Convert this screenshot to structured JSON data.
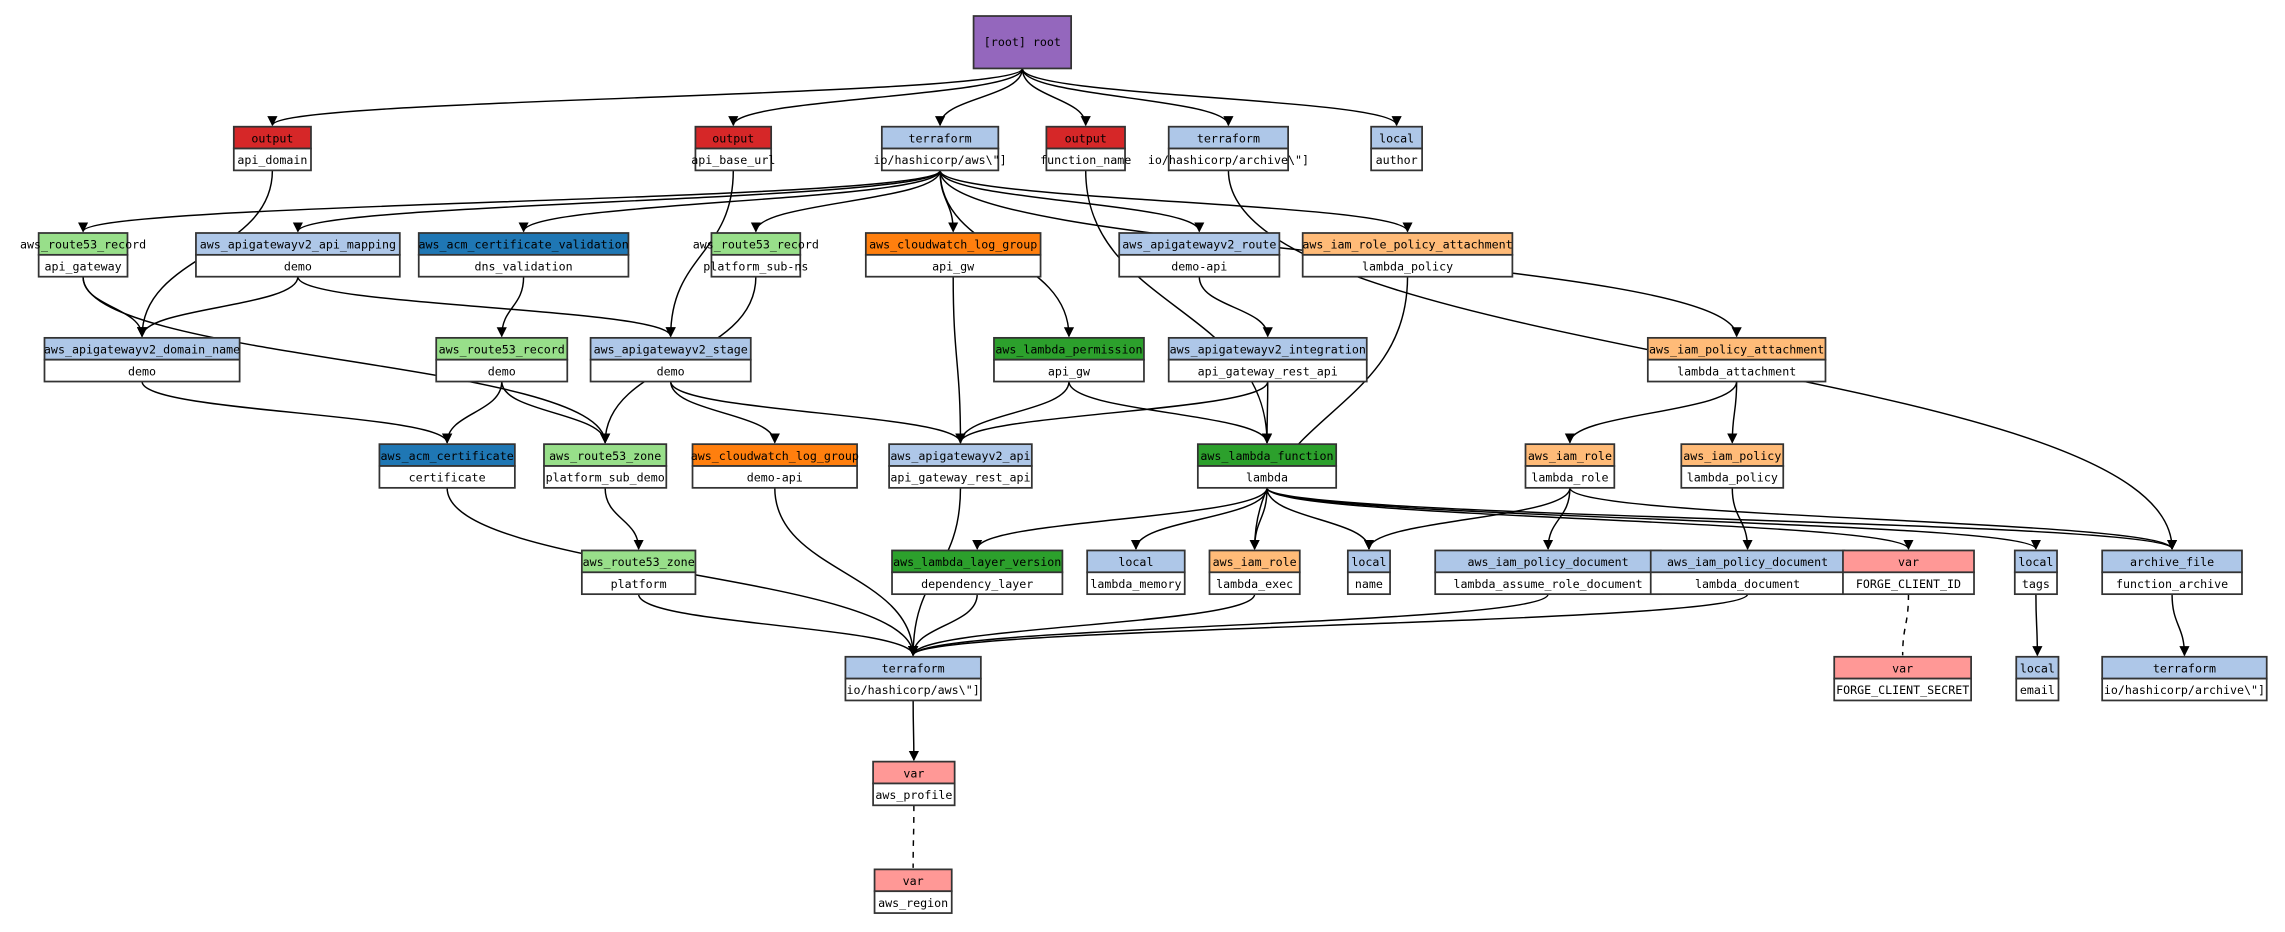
{
  "colors": {
    "root": "#9467bd",
    "output": "#d62728",
    "provider": "#aec7e8",
    "local": "#aec7e8",
    "apigateway": "#aec7e8",
    "route53": "#98df8a",
    "acm": "#1f77b4",
    "cloudwatch": "#ff7f0e",
    "lambda": "#2ca02c",
    "iam": "#ffbb78",
    "var": "#ff9896",
    "archive": "#aec7e8"
  },
  "nodes": [
    {
      "id": "root",
      "label": "[root] root",
      "color": "root"
    },
    {
      "id": "out_api_domain",
      "type": "output",
      "name": "api_domain",
      "color": "output"
    },
    {
      "id": "out_api_base_url",
      "type": "output",
      "name": "api_base_url",
      "color": "output"
    },
    {
      "id": "tf_aws_top",
      "type": "terraform",
      "name": "io/hashicorp/aws\\\"]",
      "color": "provider"
    },
    {
      "id": "out_function_name",
      "type": "output",
      "name": "function_name",
      "color": "output"
    },
    {
      "id": "tf_archive_top",
      "type": "terraform",
      "name": "io/hashicorp/archive\\\"]",
      "color": "provider"
    },
    {
      "id": "local_author",
      "type": "local",
      "name": "author",
      "color": "local"
    },
    {
      "id": "r53rec_api_gateway",
      "type": "aws_route53_record",
      "name": "api_gateway",
      "color": "route53"
    },
    {
      "id": "api_mapping",
      "type": "aws_apigatewayv2_api_mapping",
      "name": "demo",
      "color": "apigateway"
    },
    {
      "id": "acm_validation",
      "type": "aws_acm_certificate_validation",
      "name": "dns_validation",
      "color": "acm"
    },
    {
      "id": "r53rec_platform_sub_ns",
      "type": "aws_route53_record",
      "name": "platform_sub-ns",
      "color": "route53"
    },
    {
      "id": "cw_api_gw",
      "type": "aws_cloudwatch_log_group",
      "name": "api_gw",
      "color": "cloudwatch"
    },
    {
      "id": "apigw_route",
      "type": "aws_apigatewayv2_route",
      "name": "demo-api",
      "color": "apigateway"
    },
    {
      "id": "iam_rpa",
      "type": "aws_iam_role_policy_attachment",
      "name": "lambda_policy",
      "color": "iam"
    },
    {
      "id": "domain_name",
      "type": "aws_apigatewayv2_domain_name",
      "name": "demo",
      "color": "apigateway"
    },
    {
      "id": "r53rec_demo",
      "type": "aws_route53_record",
      "name": "demo",
      "color": "route53"
    },
    {
      "id": "apigw_stage",
      "type": "aws_apigatewayv2_stage",
      "name": "demo",
      "color": "apigateway"
    },
    {
      "id": "lambda_perm",
      "type": "aws_lambda_permission",
      "name": "api_gw",
      "color": "lambda"
    },
    {
      "id": "apigw_integration",
      "type": "aws_apigatewayv2_integration",
      "name": "api_gateway_rest_api",
      "color": "apigateway"
    },
    {
      "id": "iam_pa",
      "type": "aws_iam_policy_attachment",
      "name": "lambda_attachment",
      "color": "iam"
    },
    {
      "id": "acm_cert",
      "type": "aws_acm_certificate",
      "name": "certificate",
      "color": "acm"
    },
    {
      "id": "r53zone_psd",
      "type": "aws_route53_zone",
      "name": "platform_sub_demo",
      "color": "route53"
    },
    {
      "id": "cw_demo_api",
      "type": "aws_cloudwatch_log_group",
      "name": "demo-api",
      "color": "cloudwatch"
    },
    {
      "id": "apigw_api",
      "type": "aws_apigatewayv2_api",
      "name": "api_gateway_rest_api",
      "color": "apigateway"
    },
    {
      "id": "lambda_fn",
      "type": "aws_lambda_function",
      "name": "lambda",
      "color": "lambda"
    },
    {
      "id": "iam_role_lambda_role",
      "type": "aws_iam_role",
      "name": "lambda_role",
      "color": "iam"
    },
    {
      "id": "iam_policy",
      "type": "aws_iam_policy",
      "name": "lambda_policy",
      "color": "iam"
    },
    {
      "id": "r53zone_platform",
      "type": "aws_route53_zone",
      "name": "platform",
      "color": "route53"
    },
    {
      "id": "layer",
      "type": "aws_lambda_layer_version",
      "name": "dependency_layer",
      "color": "lambda"
    },
    {
      "id": "local_lambda_memory",
      "type": "local",
      "name": "lambda_memory",
      "color": "local"
    },
    {
      "id": "iam_role_exec",
      "type": "aws_iam_role",
      "name": "lambda_exec",
      "color": "iam"
    },
    {
      "id": "local_name",
      "type": "local",
      "name": "name",
      "color": "local"
    },
    {
      "id": "doc_assume",
      "type": "aws_iam_policy_document",
      "name": "lambda_assume_role_document",
      "color": "apigateway"
    },
    {
      "id": "doc_lambda",
      "type": "aws_iam_policy_document",
      "name": "lambda_document",
      "color": "apigateway"
    },
    {
      "id": "var_client_id",
      "type": "var",
      "name": "FORGE_CLIENT_ID",
      "color": "var"
    },
    {
      "id": "local_tags",
      "type": "local",
      "name": "tags",
      "color": "local"
    },
    {
      "id": "archive_file",
      "type": "archive_file",
      "name": "function_archive",
      "color": "archive"
    },
    {
      "id": "tf_aws",
      "type": "terraform",
      "name": "io/hashicorp/aws\\\"]",
      "color": "provider"
    },
    {
      "id": "var_client_secret",
      "type": "var",
      "name": "FORGE_CLIENT_SECRET",
      "color": "var"
    },
    {
      "id": "local_email",
      "type": "local",
      "name": "email",
      "color": "local"
    },
    {
      "id": "tf_archive",
      "type": "terraform",
      "name": "io/hashicorp/archive\\\"]",
      "color": "provider"
    },
    {
      "id": "var_aws_profile",
      "type": "var",
      "name": "aws_profile",
      "color": "var"
    },
    {
      "id": "var_aws_region",
      "type": "var",
      "name": "aws_region",
      "color": "var"
    }
  ],
  "edges": [
    [
      "root",
      "out_api_domain"
    ],
    [
      "root",
      "out_api_base_url"
    ],
    [
      "root",
      "tf_aws_top"
    ],
    [
      "root",
      "out_function_name"
    ],
    [
      "root",
      "tf_archive_top"
    ],
    [
      "root",
      "local_author"
    ],
    [
      "out_api_domain",
      "domain_name"
    ],
    [
      "out_api_base_url",
      "apigw_stage"
    ],
    [
      "out_function_name",
      "lambda_fn"
    ],
    [
      "tf_archive_top",
      "archive_file"
    ],
    [
      "tf_aws_top",
      "r53rec_api_gateway"
    ],
    [
      "tf_aws_top",
      "api_mapping"
    ],
    [
      "tf_aws_top",
      "acm_validation"
    ],
    [
      "tf_aws_top",
      "r53rec_platform_sub_ns"
    ],
    [
      "tf_aws_top",
      "cw_api_gw"
    ],
    [
      "tf_aws_top",
      "lambda_perm"
    ],
    [
      "tf_aws_top",
      "apigw_route"
    ],
    [
      "tf_aws_top",
      "iam_rpa"
    ],
    [
      "tf_aws_top",
      "iam_pa"
    ],
    [
      "r53rec_api_gateway",
      "domain_name"
    ],
    [
      "r53rec_api_gateway",
      "r53zone_psd"
    ],
    [
      "api_mapping",
      "domain_name"
    ],
    [
      "api_mapping",
      "apigw_stage"
    ],
    [
      "acm_validation",
      "r53rec_demo"
    ],
    [
      "r53rec_platform_sub_ns",
      "r53zone_psd"
    ],
    [
      "cw_api_gw",
      "apigw_api"
    ],
    [
      "apigw_route",
      "apigw_integration"
    ],
    [
      "iam_rpa",
      "iam_role_exec"
    ],
    [
      "domain_name",
      "acm_cert"
    ],
    [
      "r53rec_demo",
      "acm_cert"
    ],
    [
      "r53rec_demo",
      "r53zone_psd"
    ],
    [
      "apigw_stage",
      "cw_demo_api"
    ],
    [
      "apigw_stage",
      "apigw_api"
    ],
    [
      "lambda_perm",
      "apigw_api"
    ],
    [
      "lambda_perm",
      "lambda_fn"
    ],
    [
      "apigw_integration",
      "apigw_api"
    ],
    [
      "apigw_integration",
      "lambda_fn"
    ],
    [
      "iam_pa",
      "iam_role_lambda_role"
    ],
    [
      "iam_pa",
      "iam_policy"
    ],
    [
      "acm_cert",
      "tf_aws"
    ],
    [
      "r53zone_psd",
      "r53zone_platform"
    ],
    [
      "cw_demo_api",
      "tf_aws"
    ],
    [
      "apigw_api",
      "tf_aws"
    ],
    [
      "lambda_fn",
      "layer"
    ],
    [
      "lambda_fn",
      "local_lambda_memory"
    ],
    [
      "lambda_fn",
      "iam_role_exec"
    ],
    [
      "lambda_fn",
      "local_name"
    ],
    [
      "lambda_fn",
      "var_client_id"
    ],
    [
      "lambda_fn",
      "local_tags"
    ],
    [
      "lambda_fn",
      "archive_file"
    ],
    [
      "iam_role_lambda_role",
      "local_name"
    ],
    [
      "iam_role_lambda_role",
      "doc_assume"
    ],
    [
      "iam_role_lambda_role",
      "archive_file"
    ],
    [
      "iam_policy",
      "doc_lambda"
    ],
    [
      "r53zone_platform",
      "tf_aws"
    ],
    [
      "layer",
      "tf_aws"
    ],
    [
      "iam_role_exec",
      "tf_aws"
    ],
    [
      "doc_assume",
      "tf_aws"
    ],
    [
      "doc_lambda",
      "tf_aws"
    ],
    [
      "local_tags",
      "local_email"
    ],
    [
      "archive_file",
      "tf_archive"
    ],
    [
      "tf_aws",
      "var_aws_profile"
    ]
  ],
  "dashed_edges": [
    [
      "var_client_id",
      "var_client_secret"
    ],
    [
      "var_aws_profile",
      "var_aws_region"
    ]
  ]
}
